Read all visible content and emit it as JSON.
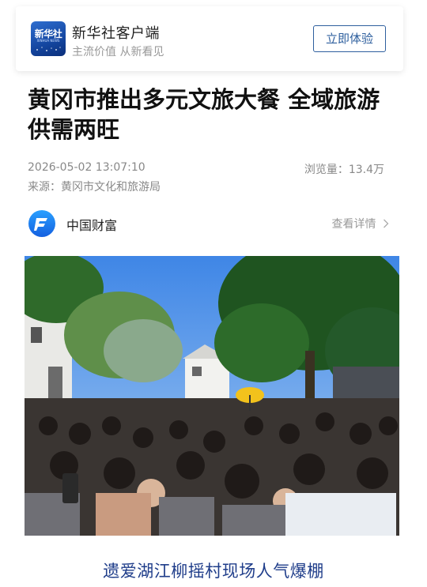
{
  "app_banner": {
    "logo_text": "新华社",
    "logo_subtext": "XINHUA NEWS",
    "name": "新华社客户端",
    "slogan": "主流价值 从新看见",
    "try_button": "立即体验"
  },
  "article": {
    "title": "黄冈市推出多元文旅大餐 全域旅游供需两旺",
    "datetime": "2026-05-02 13:07:10",
    "views": "浏览量：13.4万",
    "source": "来源：黄冈市文化和旅游局"
  },
  "author": {
    "name": "中国财富",
    "detail_link": "查看详情"
  },
  "photo": {
    "caption": "遗爱湖江柳摇村现场人气爆棚"
  },
  "colors": {
    "brand_blue": "#2e5f9e",
    "caption_blue": "#1f3d8a",
    "meta_gray": "#888888"
  },
  "icons": [
    "xinhua-logo-icon",
    "china-wealth-logo-icon",
    "chevron-right-icon"
  ]
}
